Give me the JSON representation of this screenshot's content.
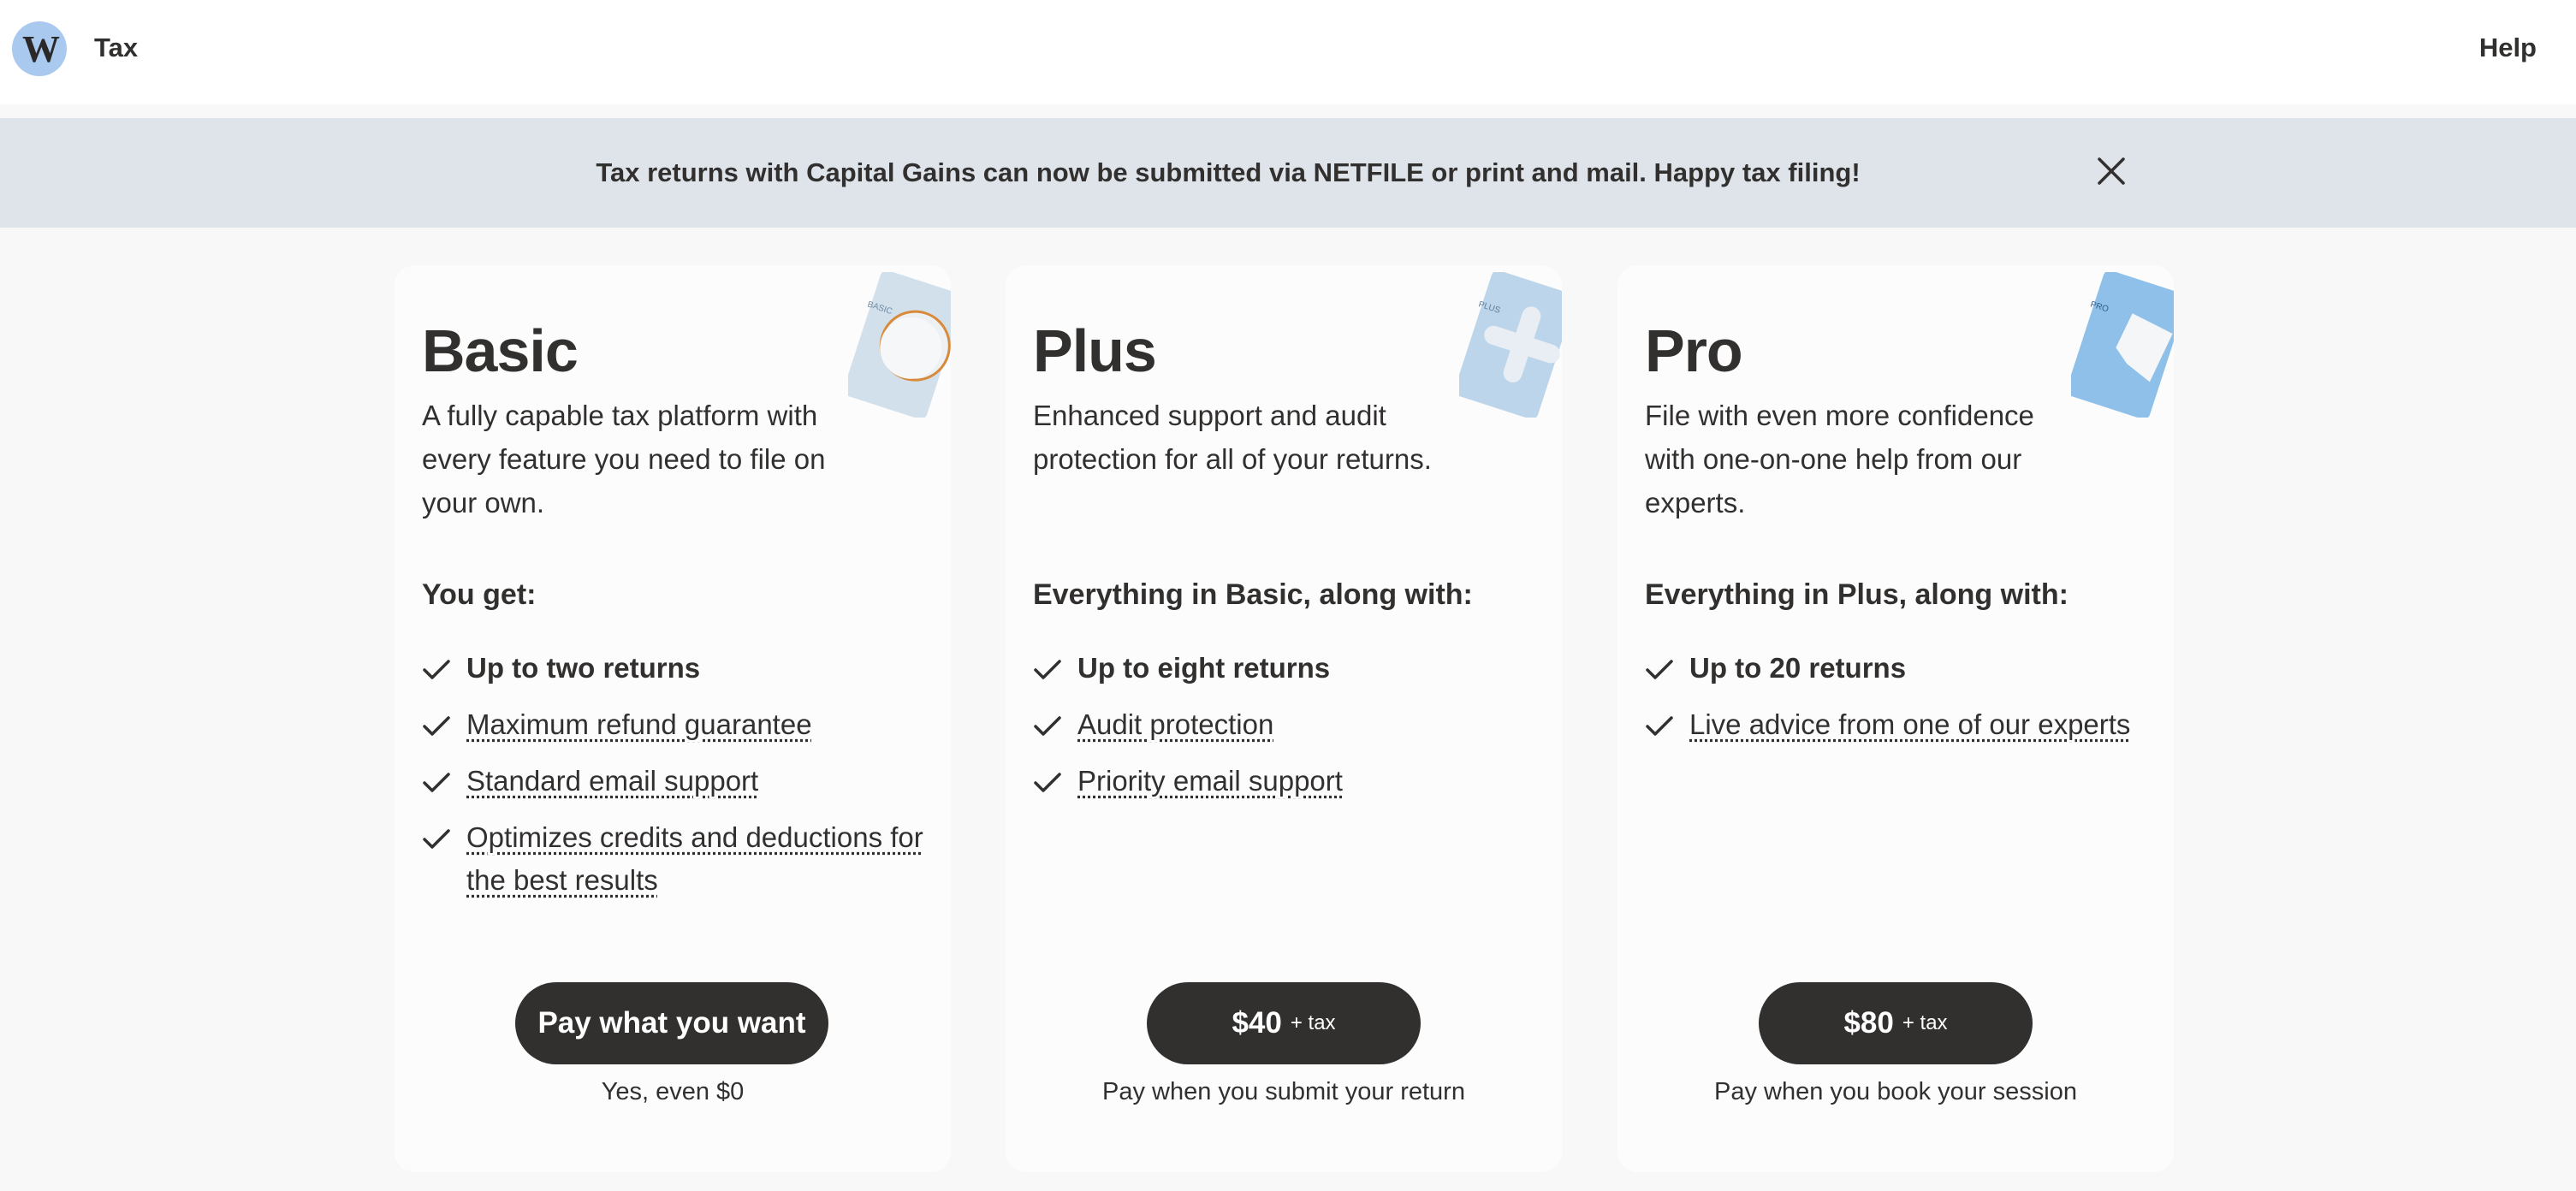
{
  "header": {
    "logo_letter": "W",
    "title": "Tax",
    "help_label": "Help"
  },
  "banner": {
    "message": "Tax returns with Capital Gains can now be submitted via NETFILE or print and mail. Happy tax filing!",
    "close_icon": "close-icon"
  },
  "plans": [
    {
      "name": "Basic",
      "card_label": "BASIC",
      "description": "A fully capable tax platform with every feature you need to file on your own.",
      "features_heading": "You get:",
      "features": [
        {
          "label": "Up to two returns",
          "style": "strong"
        },
        {
          "label": "Maximum refund guarantee",
          "style": "link"
        },
        {
          "label": "Standard email support",
          "style": "link"
        },
        {
          "label": "Optimizes credits and deductions for the best results",
          "style": "link"
        }
      ],
      "cta_main": "Pay what you want",
      "cta_sub": "",
      "cta_note": "Yes, even $0"
    },
    {
      "name": "Plus",
      "card_label": "PLUS",
      "description": "Enhanced support and audit protection for all of your returns.",
      "features_heading": "Everything in Basic, along with:",
      "features": [
        {
          "label": "Up to eight returns",
          "style": "strong"
        },
        {
          "label": "Audit protection",
          "style": "link"
        },
        {
          "label": "Priority email support",
          "style": "link"
        }
      ],
      "cta_main": "$40",
      "cta_sub": "+ tax",
      "cta_note": "Pay when you submit your return"
    },
    {
      "name": "Pro",
      "card_label": "PRO",
      "description": "File with even more confidence with one-on-one help from our experts.",
      "features_heading": "Everything in Plus, along with:",
      "features": [
        {
          "label": "Up to 20 returns",
          "style": "strong"
        },
        {
          "label": "Live advice from one of our experts",
          "style": "link"
        }
      ],
      "cta_main": "$80",
      "cta_sub": "+ tax",
      "cta_note": "Pay when you book your session"
    }
  ],
  "colors": {
    "brand_circle": "#a9c9ee",
    "banner_bg": "#dee4ea",
    "button_bg": "#32302f",
    "text": "#32302f"
  }
}
